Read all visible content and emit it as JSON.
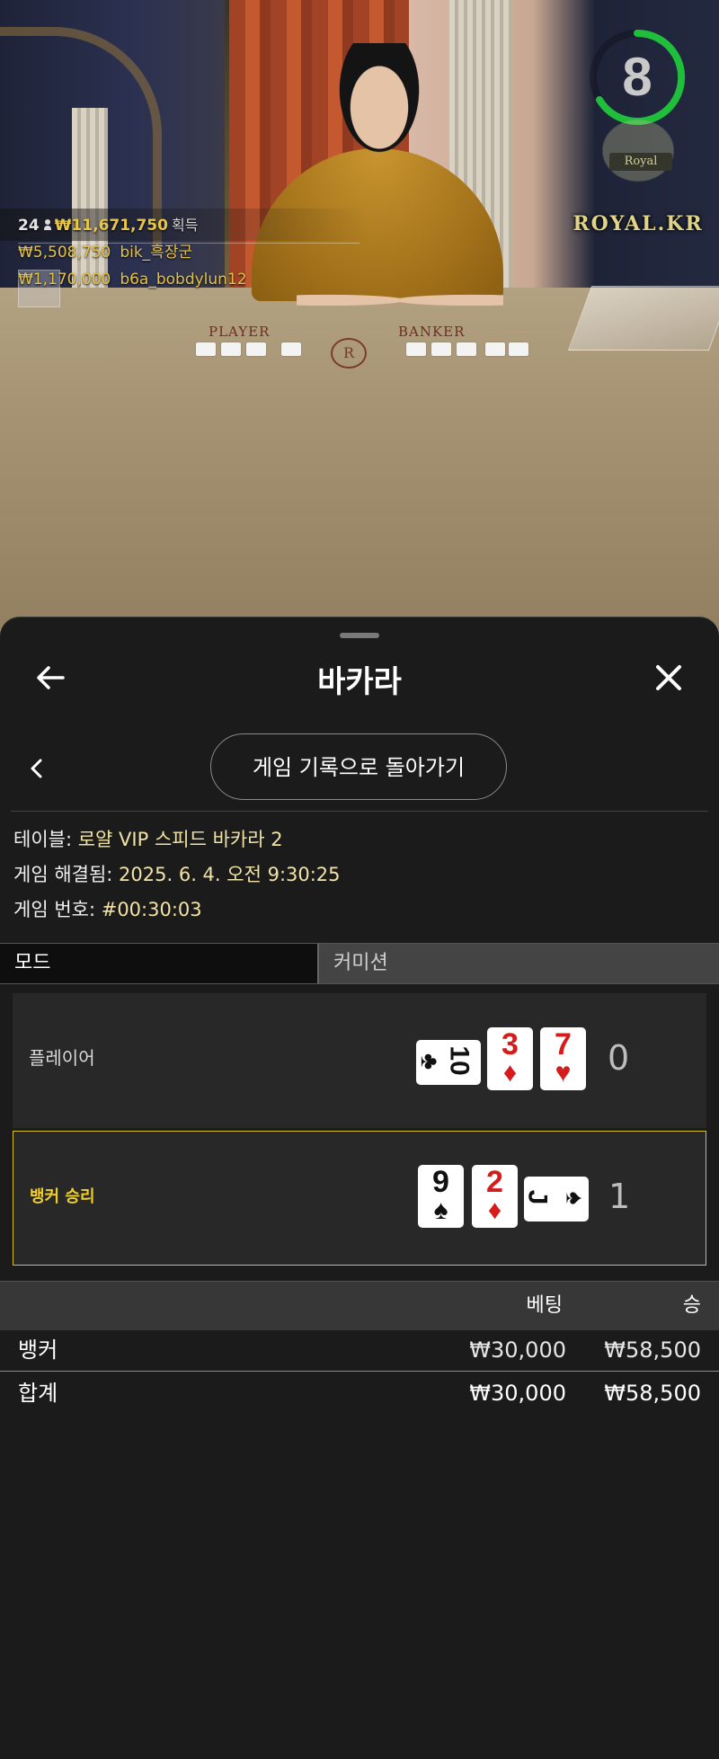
{
  "stream": {
    "winners_count": "24",
    "winners_total": "₩11,671,750",
    "winners_suffix": "획득",
    "winners_list": [
      {
        "amount": "₩5,508,750",
        "user": "bik_흑장군"
      },
      {
        "amount": "₩1,170,000",
        "user": "b6a_bobdylun12"
      }
    ],
    "timer": "8",
    "felt_player": "PLAYER",
    "felt_banker": "BANKER",
    "crest_text": "Royal",
    "brand": "ROYAL.KR"
  },
  "sheet": {
    "title": "바카라",
    "back_icon": "arrow-left-icon",
    "close_icon": "close-icon",
    "history_button": "게임 기록으로 돌아가기",
    "info": {
      "table_label": "테이블:",
      "table_value": "로얄 VIP 스피드 바카라 2",
      "resolved_label": "게임 해결됨:",
      "resolved_value": "2025. 6. 4. 오전 9:30:25",
      "number_label": "게임 번호:",
      "number_value": "#00:30:03"
    },
    "tabs": [
      "모드",
      "커미션"
    ],
    "hands": {
      "player": {
        "label": "플레이어",
        "score": "0",
        "cards": [
          {
            "rank": "10",
            "suit": "♣",
            "color": "black",
            "sideways": true
          },
          {
            "rank": "3",
            "suit": "♦",
            "color": "red",
            "sideways": false
          },
          {
            "rank": "7",
            "suit": "♥",
            "color": "red",
            "sideways": false
          }
        ]
      },
      "banker": {
        "label": "뱅커 승리",
        "score": "1",
        "cards": [
          {
            "rank": "9",
            "suit": "♠",
            "color": "black",
            "sideways": false
          },
          {
            "rank": "2",
            "suit": "♦",
            "color": "red",
            "sideways": false
          },
          {
            "rank": "J",
            "suit": "♠",
            "color": "black",
            "sideways": true
          }
        ]
      }
    },
    "bets": {
      "header_bet": "베팅",
      "header_win": "승",
      "rows": [
        {
          "name": "뱅커",
          "bet": "₩30,000",
          "win": "₩58,500"
        }
      ],
      "total": {
        "name": "합계",
        "bet": "₩30,000",
        "win": "₩58,500"
      }
    },
    "colors": {
      "accent_gold": "#f0cf2b",
      "value_text": "#f1e3a6",
      "timer_green": "#1fbf3c"
    }
  }
}
